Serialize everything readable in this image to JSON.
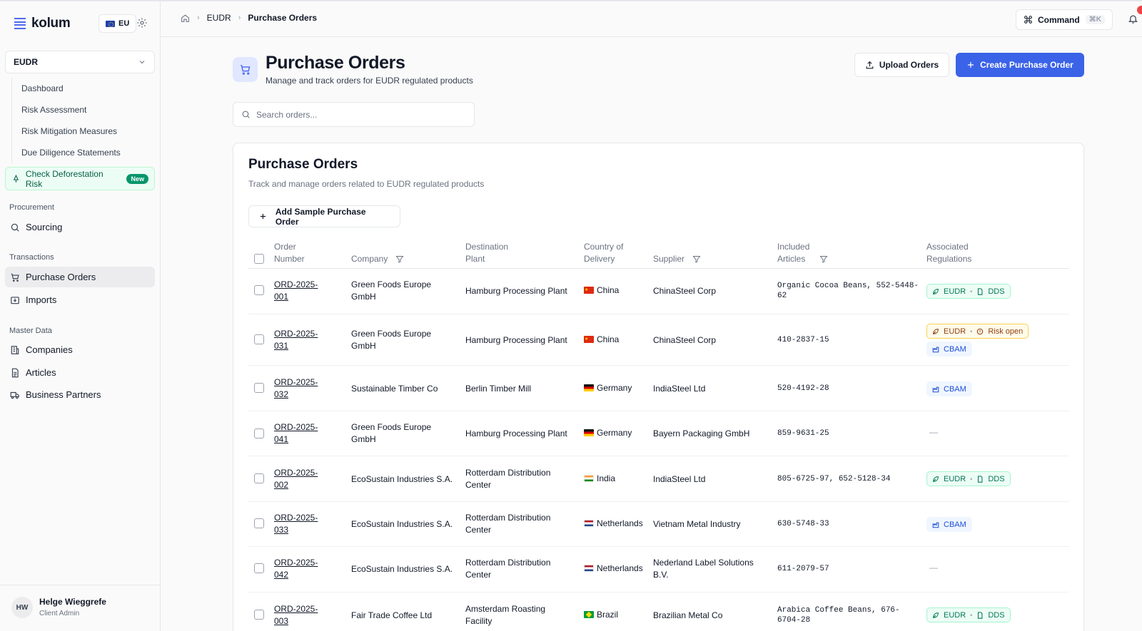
{
  "app": {
    "logo": "kolum",
    "region": "EU"
  },
  "sidebar": {
    "module": "EUDR",
    "subnav": [
      "Dashboard",
      "Risk Assessment",
      "Risk Mitigation Measures",
      "Due Diligence Statements"
    ],
    "check_risk": {
      "label": "Check Deforestation Risk",
      "badge": "New"
    },
    "sections": {
      "procurement": {
        "label": "Procurement",
        "items": [
          "Sourcing"
        ]
      },
      "transactions": {
        "label": "Transactions",
        "items": [
          "Purchase Orders",
          "Imports"
        ]
      },
      "master_data": {
        "label": "Master Data",
        "items": [
          "Companies",
          "Articles",
          "Business Partners"
        ]
      }
    },
    "user": {
      "initials": "HW",
      "name": "Helge Wieggrefe",
      "role": "Client Admin"
    }
  },
  "header": {
    "breadcrumb": [
      "EUDR",
      "Purchase Orders"
    ],
    "command": {
      "label": "Command",
      "shortcut": "⌘K"
    }
  },
  "page": {
    "title": "Purchase Orders",
    "subtitle": "Manage and track orders for EUDR regulated products",
    "upload_label": "Upload Orders",
    "create_label": "Create Purchase Order",
    "search_placeholder": "Search orders..."
  },
  "card": {
    "title": "Purchase Orders",
    "subtitle": "Track and manage orders related to EUDR regulated products",
    "sample_button": "Add Sample Purchase Order"
  },
  "table": {
    "columns": {
      "order_1": "Order",
      "order_2": "Number",
      "company": "Company",
      "plant_1": "Destination",
      "plant_2": "Plant",
      "country_1": "Country of",
      "country_2": "Delivery",
      "supplier": "Supplier",
      "articles_1": "Included",
      "articles_2": "Articles",
      "regs_1": "Associated",
      "regs_2": "Regulations"
    },
    "rows": [
      {
        "order_1": "ORD-2025-",
        "order_2": "001",
        "company_1": "Green Foods Europe",
        "company_2": "GmbH",
        "plant_1": "Hamburg Processing Plant",
        "plant_2": "",
        "country": "China",
        "supplier_1": "ChinaSteel Corp",
        "supplier_2": "",
        "articles_1": "Organic Cocoa Beans, 552-5448-",
        "articles_2": "62",
        "regs": "EUDR · DDS"
      },
      {
        "order_1": "ORD-2025-",
        "order_2": "031",
        "company_1": "Green Foods Europe",
        "company_2": "GmbH",
        "plant_1": "Hamburg Processing Plant",
        "plant_2": "",
        "country": "China",
        "supplier_1": "ChinaSteel Corp",
        "supplier_2": "",
        "articles_1": "410-2837-15",
        "articles_2": "",
        "regs": "EUDR · Risk open + CBAM"
      },
      {
        "order_1": "ORD-2025-",
        "order_2": "032",
        "company_1": "Sustainable Timber Co",
        "company_2": "",
        "plant_1": "Berlin Timber Mill",
        "plant_2": "",
        "country": "Germany",
        "supplier_1": "IndiaSteel Ltd",
        "supplier_2": "",
        "articles_1": "520-4192-28",
        "articles_2": "",
        "regs": "CBAM"
      },
      {
        "order_1": "ORD-2025-",
        "order_2": "041",
        "company_1": "Green Foods Europe",
        "company_2": "GmbH",
        "plant_1": "Hamburg Processing Plant",
        "plant_2": "",
        "country": "Germany",
        "supplier_1": "Bayern Packaging GmbH",
        "supplier_2": "",
        "articles_1": "859-9631-25",
        "articles_2": "",
        "regs": "—"
      },
      {
        "order_1": "ORD-2025-",
        "order_2": "002",
        "company_1": "EcoSustain Industries S.A.",
        "company_2": "",
        "plant_1": "Rotterdam Distribution",
        "plant_2": "Center",
        "country": "India",
        "supplier_1": "IndiaSteel Ltd",
        "supplier_2": "",
        "articles_1": "805-6725-97, 652-5128-34",
        "articles_2": "",
        "regs": "EUDR · DDS"
      },
      {
        "order_1": "ORD-2025-",
        "order_2": "033",
        "company_1": "EcoSustain Industries S.A.",
        "company_2": "",
        "plant_1": "Rotterdam Distribution",
        "plant_2": "Center",
        "country": "Netherlands",
        "supplier_1": "Vietnam Metal Industry",
        "supplier_2": "",
        "articles_1": "630-5748-33",
        "articles_2": "",
        "regs": "CBAM"
      },
      {
        "order_1": "ORD-2025-",
        "order_2": "042",
        "company_1": "EcoSustain Industries S.A.",
        "company_2": "",
        "plant_1": "Rotterdam Distribution",
        "plant_2": "Center",
        "country": "Netherlands",
        "supplier_1": "Nederland Label Solutions",
        "supplier_2": "B.V.",
        "articles_1": "611-2079-57",
        "articles_2": "",
        "regs": "—"
      },
      {
        "order_1": "ORD-2025-",
        "order_2": "003",
        "company_1": "Fair Trade Coffee Ltd",
        "company_2": "",
        "plant_1": "Amsterdam Roasting",
        "plant_2": "Facility",
        "country": "Brazil",
        "supplier_1": "Brazilian Metal Co",
        "supplier_2": "",
        "articles_1": "Arabica Coffee Beans, 676-",
        "articles_2": "6704-28",
        "regs": "EUDR · DDS"
      }
    ],
    "badge_labels": {
      "eudr": "EUDR",
      "dds": "DDS",
      "risk_open": "Risk open",
      "cbam": "CBAM",
      "none": "—"
    }
  }
}
